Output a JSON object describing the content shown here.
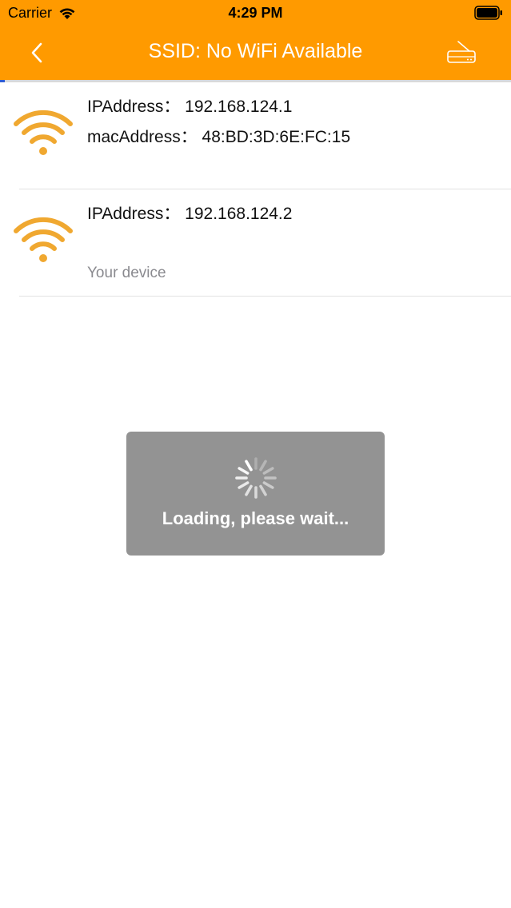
{
  "status_bar": {
    "carrier": "Carrier",
    "time": "4:29 PM",
    "icons": [
      "wifi-signal-icon",
      "battery-icon"
    ]
  },
  "nav": {
    "title": "SSID: No WiFi Available",
    "back_icon": "chevron-left-icon",
    "right_icon": "router-icon"
  },
  "colors": {
    "header_bg": "#FF9A00",
    "wifi_icon": "#F0A830",
    "progress": "#2F5BD3",
    "overlay_bg": "#8A8A8A"
  },
  "progress": {
    "fraction": 0.01
  },
  "devices": [
    {
      "line1": "IPAddress： 192.168.124.1",
      "line2": "macAddress： 48:BD:3D:6E:FC:15",
      "note": "",
      "icon": "wifi-icon"
    },
    {
      "line1": "IPAddress： 192.168.124.2",
      "line2": "",
      "note": "Your device",
      "icon": "wifi-icon"
    }
  ],
  "loading": {
    "text": "Loading, please wait...",
    "icon": "spinner-icon"
  }
}
